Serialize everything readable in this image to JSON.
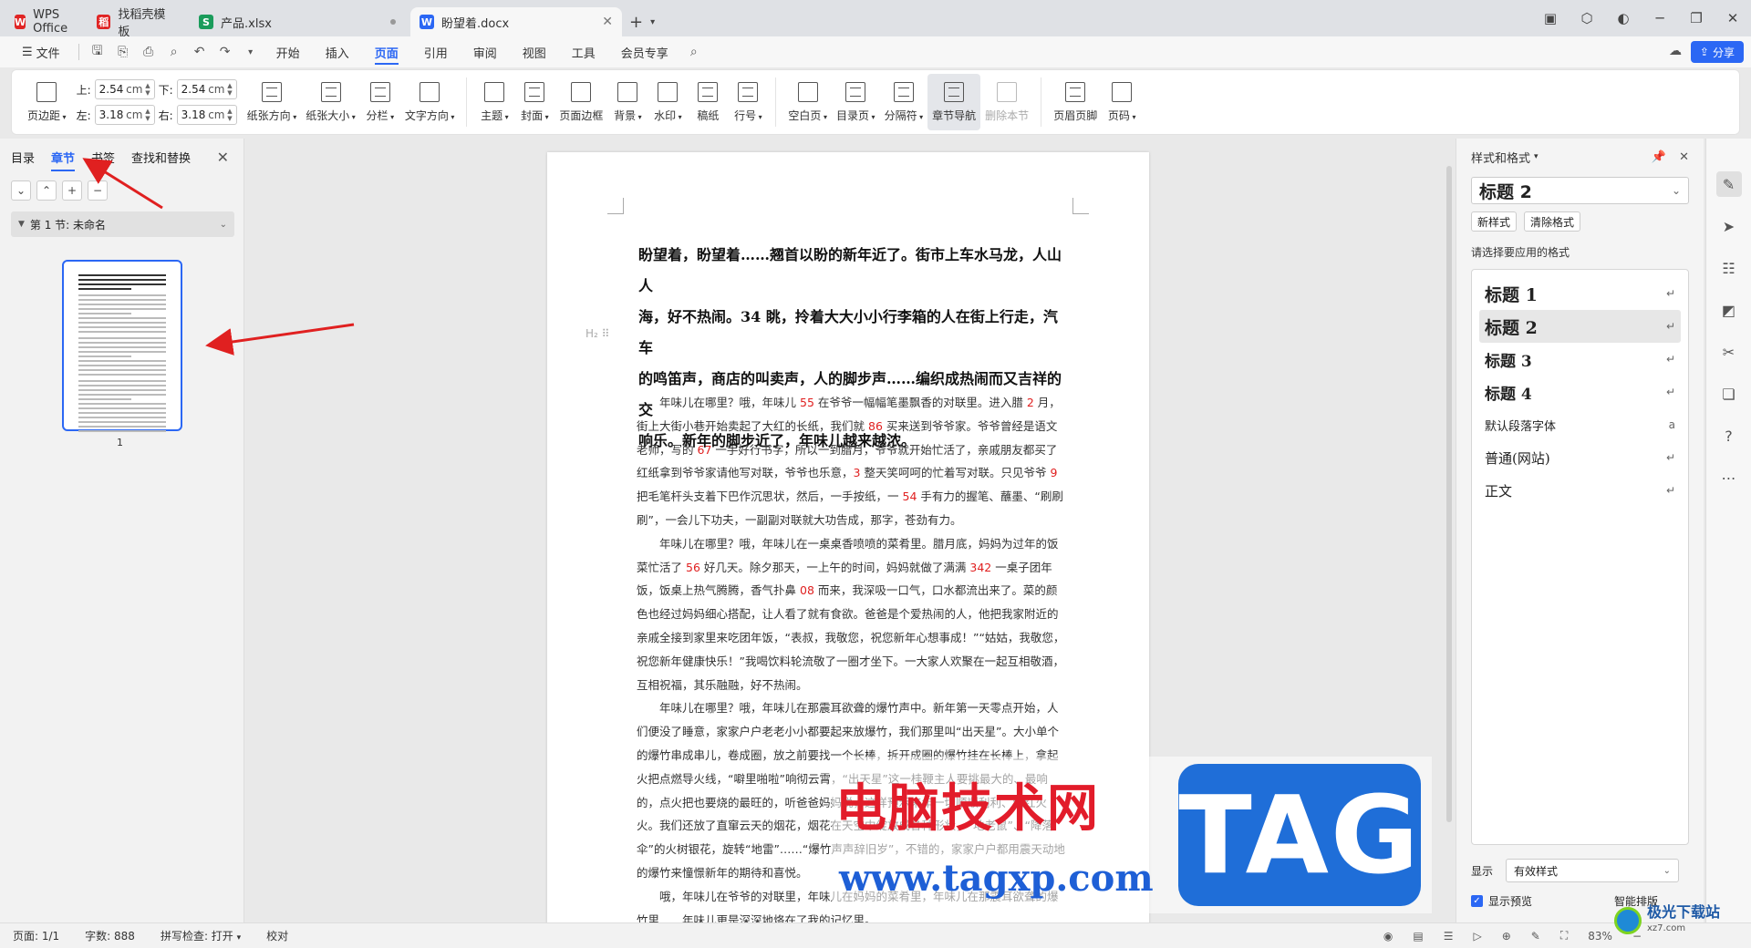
{
  "tabs": [
    {
      "label": "WPS Office",
      "icon": "W",
      "color": "#e02424"
    },
    {
      "label": "找稻壳模板",
      "icon": "稻",
      "color": "#e02424"
    },
    {
      "label": "产品.xlsx",
      "icon": "S",
      "color": "#1a9c5b"
    },
    {
      "label": "盼望着.docx",
      "icon": "W",
      "color": "#2b67f4"
    }
  ],
  "menubar": {
    "file": "文件",
    "items": [
      "开始",
      "插入",
      "页面",
      "引用",
      "审阅",
      "视图",
      "工具",
      "会员专享"
    ],
    "active": "页面",
    "share": "分享"
  },
  "ribbon": {
    "page_margin": "页边距",
    "margins": {
      "top_label": "上:",
      "top": "2.54",
      "bottom_label": "下:",
      "bottom": "2.54",
      "left_label": "左:",
      "left": "3.18",
      "right_label": "右:",
      "right": "3.18",
      "unit": "cm"
    },
    "orientation": "纸张方向",
    "size": "纸张大小",
    "columns": "分栏",
    "text_direction": "文字方向",
    "theme": "主题",
    "cover": "封面",
    "page_border": "页面边框",
    "background": "背景",
    "watermark": "水印",
    "manuscript": "稿纸",
    "line_number": "行号",
    "blank_page": "空白页",
    "toc_page": "目录页",
    "separator": "分隔符",
    "section_nav": "章节导航",
    "delete_section": "删除本节",
    "header_footer": "页眉页脚",
    "page_number": "页码"
  },
  "navpane": {
    "tabs": [
      "目录",
      "章节",
      "书签",
      "查找和替换"
    ],
    "active": "章节",
    "section_label": "第 1 节: 未命名",
    "page_number": "1"
  },
  "document": {
    "heading_lines": [
      "盼望着，盼望着……翘首以盼的新年近了。街市上车水马龙，人山人",
      "海，好不热闹。34 眺，拎着大大小小行李箱的人在街上行走，汽车",
      "的鸣笛声，商店的叫卖声，人的脚步声……编织成热闹而又吉祥的交",
      "响乐。新年的脚步近了，年味儿越来越浓。"
    ],
    "heading_marker": "H₂",
    "paragraphs": [
      "年味儿在哪里？哦，年味儿 55 在爷爷一幅幅笔墨飘香的对联里。进入腊 2 月，街上大街小巷开始卖起了大红的长纸，我们就 86 买来送到爷爷家。爷爷曾经是语文老师，写的 67 一手好行书字，所以一到腊月，爷爷就开始忙活了，亲戚朋友都买了红纸拿到爷爷家请他写对联，爷爷也乐意，3 整天笑呵呵的忙着写对联。只见爷爷 9 把毛笔杆头支着下巴作沉思状，然后，一手按纸，一 54 手有力的握笔、蘸墨、“刷刷刷”，一会儿下功夫，一副副对联就大功告成，那字，苍劲有力。",
      "年味儿在哪里？哦，年味儿在一桌桌香喷喷的菜肴里。腊月底，妈妈为过年的饭菜忙活了 56 好几天。除夕那天，一上午的时间，妈妈就做了满满 342 一桌子团年饭，饭桌上热气腾腾，香气扑鼻 08 而来，我深吸一口气，口水都流出来了。菜的颜色也经过妈妈细心搭配，让人看了就有食欲。爸爸是个爱热闹的人，他把我家附近的亲戚全接到家里来吃团年饭，“表叔，我敬您，祝您新年心想事成！”“姑姑，我敬您，祝您新年健康快乐！”我喝饮料轮流敬了一圈才坐下。一大家人欢聚在一起互相敬酒，互相祝福，其乐融融，好不热闹。",
      "年味儿在哪里？哦，年味儿在那震耳欲聋的爆竹声中。新年第一天零点开始，人们便没了睡意，家家户户老老小小都要起来放爆竹，我们那里叫“出天星”。大小单个的爆竹串成串儿，卷成圈，放之前要找一个长棒，拆开成圈的爆竹挂在长棒上，拿起火把点燃导火线，“噼里啪啦”响彻云霄，“出天星”这一桂鞭主人要挑最大的、最响的，点火把也要烧的最旺的，听爸爸妈妈说，这样预示来年一切顺顺利利、红红火火。我们还放了直窜云天的烟花，烟花在天空中绽放成各种形状，“地老鼠”、“降落伞”的火树银花，旋转“地雷”……“爆竹声声辞旧岁”，不错的，家家户户都用震天动地的爆竹来憧憬新年的期待和喜悦。",
      "哦，年味儿在爷爷的对联里，年味儿在妈妈的菜肴里，年味儿在那震耳欲聋的爆竹里……年味儿更是深深地烙在了我的记忆里。"
    ]
  },
  "stylepane": {
    "title": "样式和格式",
    "current": "标题 2",
    "new_style": "新样式",
    "clear_format": "清除格式",
    "prompt": "请选择要应用的格式",
    "styles": [
      "标题 1",
      "标题 2",
      "标题 3",
      "标题 4",
      "默认段落字体",
      "普通(网站)",
      "正文"
    ],
    "selected": "标题 2",
    "show_label": "显示",
    "show_value": "有效样式",
    "preview_label": "显示预览",
    "smart_layout": "智能排版"
  },
  "statusbar": {
    "page": "页面: 1/1",
    "words": "字数: 888",
    "spell": "拼写检查: 打开",
    "proof": "校对",
    "zoom": "83%"
  },
  "watermark": {
    "text": "电脑技术网",
    "url": "www.tagxp.com",
    "tag": "TAG",
    "corner_text": "极光下载站",
    "corner_sub": "xz7.com"
  },
  "colors": {
    "accent": "#2b67f4",
    "arrow": "#e02020",
    "number_red": "#e02020"
  }
}
